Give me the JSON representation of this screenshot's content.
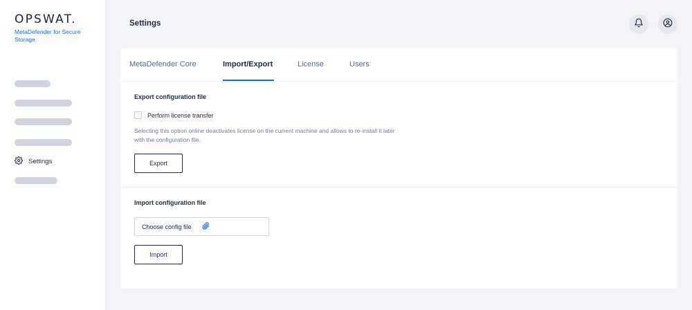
{
  "brand": {
    "name": "OPSWAT.",
    "product": "MetaDefender for Secure Storage"
  },
  "sidebar": {
    "active_item": "Settings"
  },
  "header": {
    "title": "Settings",
    "icons": [
      "bell-icon",
      "user-icon"
    ]
  },
  "tabs": [
    {
      "label": "MetaDefender Core"
    },
    {
      "label": "Import/Export"
    },
    {
      "label": "License"
    },
    {
      "label": "Users"
    }
  ],
  "active_tab": "Import/Export",
  "export": {
    "title": "Export configuration file",
    "checkbox_label": "Perform license transfer",
    "checkbox_checked": false,
    "help_text": "Selecting this option online deactivates license on the current machine and allows to re-install it later with the configuration file.",
    "button_label": "Export"
  },
  "import": {
    "title": "Import configuration file",
    "file_placeholder": "Choose config file",
    "button_label": "Import"
  },
  "colors": {
    "accent": "#1d6bd6",
    "background": "#f3f4f8",
    "text": "#1f2a44"
  }
}
